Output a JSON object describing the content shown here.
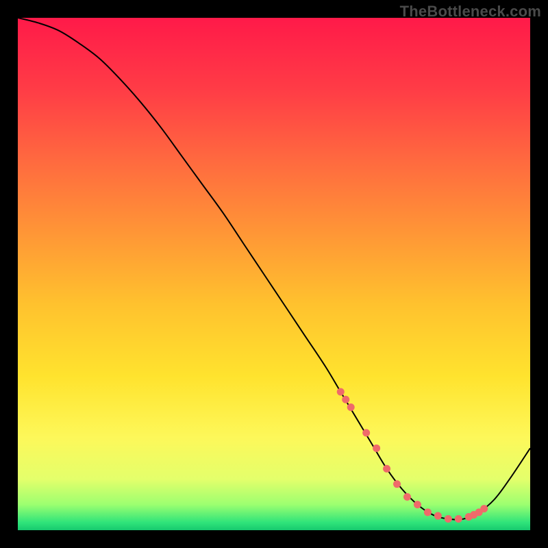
{
  "watermark": "TheBottleneck.com",
  "chart_data": {
    "type": "line",
    "title": "",
    "xlabel": "",
    "ylabel": "",
    "xlim": [
      0,
      100
    ],
    "ylim": [
      0,
      100
    ],
    "grid": false,
    "series": [
      {
        "name": "curve",
        "color": "#000000",
        "x": [
          0,
          4,
          8,
          12,
          16,
          20,
          24,
          28,
          32,
          36,
          40,
          44,
          48,
          52,
          56,
          60,
          63,
          66,
          69,
          72,
          75,
          78,
          81,
          84,
          87,
          90,
          93,
          96,
          100
        ],
        "y": [
          100,
          99,
          97.5,
          95,
          92,
          88,
          83.5,
          78.5,
          73,
          67.5,
          62,
          56,
          50,
          44,
          38,
          32,
          27,
          22,
          17,
          12,
          8,
          5,
          3,
          2.2,
          2.2,
          3.5,
          6,
          10,
          16
        ]
      },
      {
        "name": "highlight-dots",
        "color": "#ef6a6a",
        "x": [
          63,
          64,
          65,
          68,
          70,
          72,
          74,
          76,
          78,
          80,
          82,
          84,
          86,
          88,
          89,
          90,
          91
        ],
        "y": [
          27,
          25.5,
          24,
          19,
          16,
          12,
          9,
          6.5,
          5,
          3.5,
          2.8,
          2.2,
          2.2,
          2.6,
          3.0,
          3.5,
          4.2
        ]
      }
    ],
    "background_gradient": {
      "stops": [
        {
          "offset": 0.0,
          "color": "#ff1a49"
        },
        {
          "offset": 0.14,
          "color": "#ff3c46"
        },
        {
          "offset": 0.28,
          "color": "#ff6a3f"
        },
        {
          "offset": 0.42,
          "color": "#ff9636"
        },
        {
          "offset": 0.56,
          "color": "#ffc22e"
        },
        {
          "offset": 0.7,
          "color": "#ffe32e"
        },
        {
          "offset": 0.82,
          "color": "#fdf85a"
        },
        {
          "offset": 0.9,
          "color": "#e4ff6b"
        },
        {
          "offset": 0.95,
          "color": "#9cff70"
        },
        {
          "offset": 0.985,
          "color": "#2fe47a"
        },
        {
          "offset": 1.0,
          "color": "#17c96f"
        }
      ]
    }
  }
}
